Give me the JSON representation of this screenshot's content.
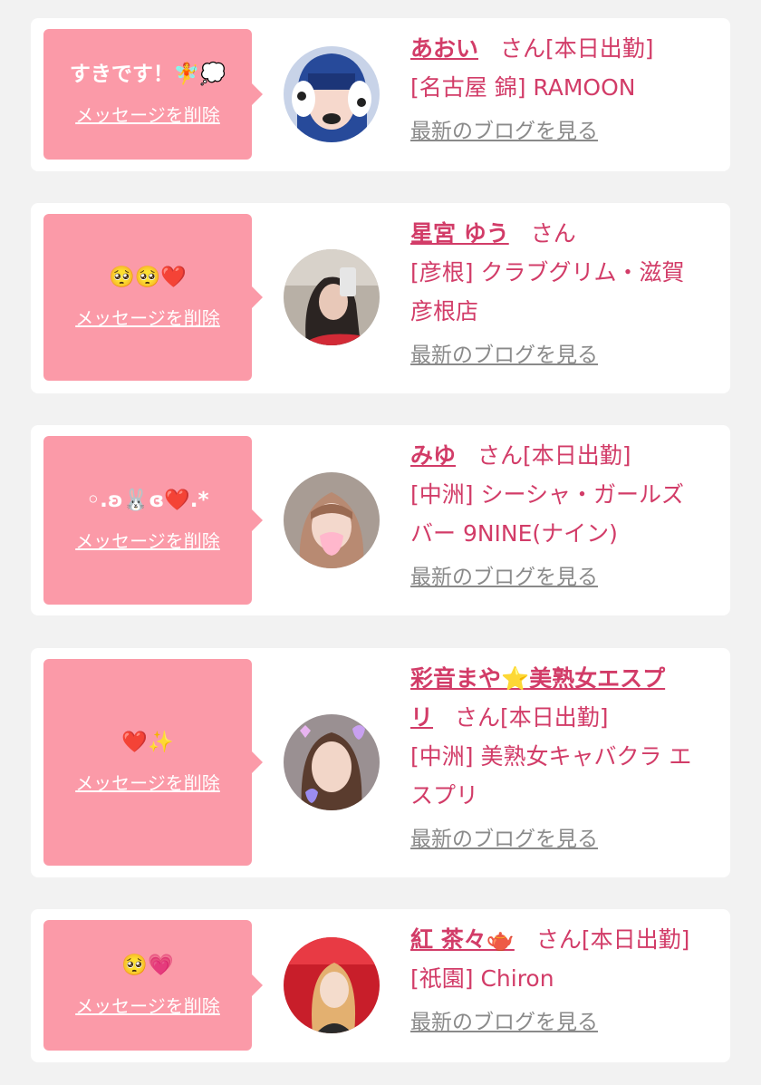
{
  "delete_label": "メッセージを削除",
  "blog_label": "最新のブログを見る",
  "honorific": "さん",
  "items": [
    {
      "message": "すきです！🧚💭",
      "name": "あおい",
      "status": "[本日出勤]",
      "shop_lines": [
        "[名古屋 錦] RAMOON"
      ]
    },
    {
      "message": "🥺🥺❤️",
      "name": "星宮 ゆう",
      "status": "",
      "shop_lines": [
        "[彦根] クラブグリム・滋賀",
        "彦根店"
      ]
    },
    {
      "message": "◦.ʚ🐰ɞ❤️.*",
      "name": "みゆ",
      "status": "[本日出勤]",
      "shop_lines": [
        "[中洲] シーシャ・ガールズ",
        "バー 9NINE(ナイン)"
      ]
    },
    {
      "message": "❤️✨",
      "name_lines": [
        "彩音まや⭐美熟女エスプ",
        "リ"
      ],
      "status": "[本日出勤]",
      "shop_lines": [
        "[中洲] 美熟女キャバクラ エ",
        "スプリ"
      ]
    },
    {
      "message": "🥺💗",
      "name": "紅 茶々🫖",
      "status": "[本日出勤]",
      "shop_lines": [
        "[祇園] Chiron"
      ]
    }
  ],
  "colors": {
    "page_bg": "#f2f2f2",
    "bubble": "#fb9aa8",
    "accent_pink": "#d23c68",
    "link_gray": "#8a8a8a"
  }
}
